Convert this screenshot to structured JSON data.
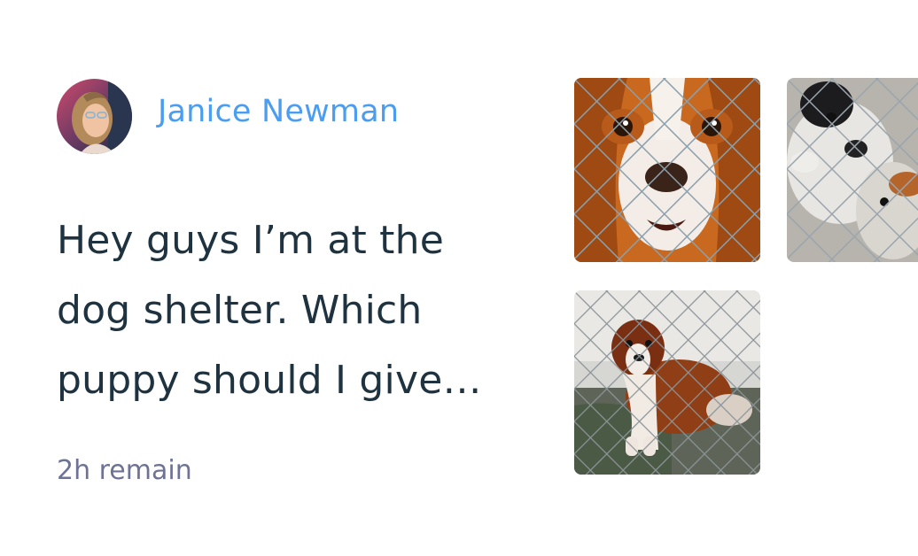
{
  "post": {
    "author_name": "Janice Newman",
    "body_lines": [
      "Hey guys I’m at the",
      "dog shelter. Which",
      "puppy should I give…"
    ],
    "time_remaining": "2h remain"
  },
  "icons": {
    "avatar": "user-avatar-photo",
    "images": [
      "spaniel-behind-fence-photo",
      "puppies-behind-fence-photo",
      "dog-in-cage-photo"
    ]
  },
  "colors": {
    "author": "#4a9df0",
    "body_text": "#1e3240",
    "meta_text": "#6e7395",
    "background": "#ffffff"
  }
}
